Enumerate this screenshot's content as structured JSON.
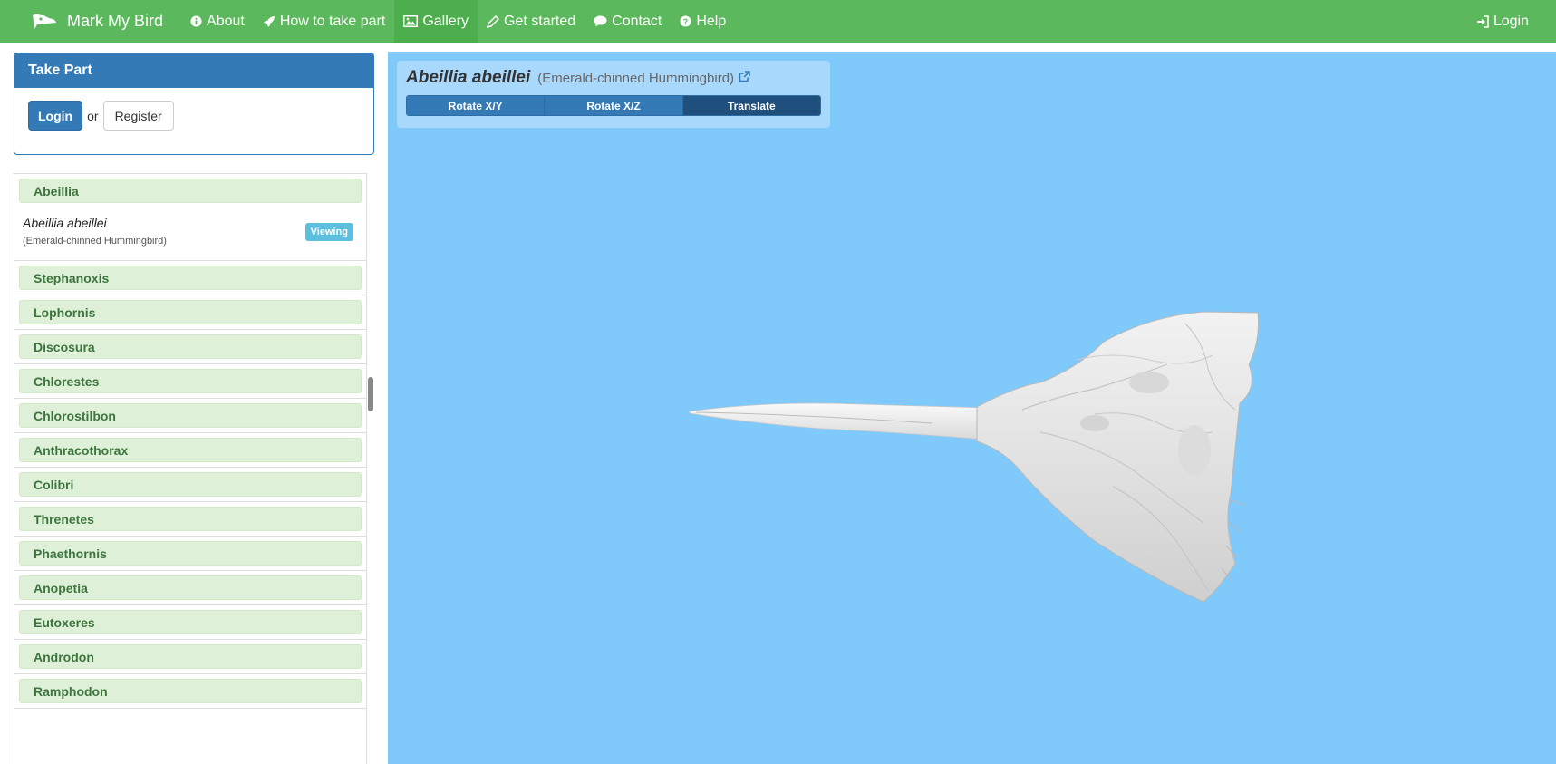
{
  "navbar": {
    "brand": "Mark My Bird",
    "items": [
      {
        "label": "About",
        "icon": "info-circle-icon"
      },
      {
        "label": "How to take part",
        "icon": "rocket-icon"
      },
      {
        "label": "Gallery",
        "icon": "picture-icon",
        "active": true
      },
      {
        "label": "Get started",
        "icon": "pencil-icon"
      },
      {
        "label": "Contact",
        "icon": "comment-icon"
      },
      {
        "label": "Help",
        "icon": "question-circle-icon"
      }
    ],
    "login": "Login"
  },
  "take_part": {
    "title": "Take Part",
    "login_label": "Login",
    "or_text": "or",
    "register_label": "Register"
  },
  "genus_list": {
    "first_genus": "Abeillia",
    "selected_species": {
      "scientific_name": "Abeillia abeillei",
      "common_name": "(Emerald-chinned Hummingbird)",
      "badge": "Viewing"
    },
    "genera": [
      "Stephanoxis",
      "Lophornis",
      "Discosura",
      "Chlorestes",
      "Chlorostilbon",
      "Anthracothorax",
      "Colibri",
      "Threnetes",
      "Phaethornis",
      "Anopetia",
      "Eutoxeres",
      "Androdon",
      "Ramphodon"
    ]
  },
  "viewer": {
    "scientific_name": "Abeillia abeillei",
    "common_name": "(Emerald-chinned Hummingbird)",
    "modes": [
      "Rotate X/Y",
      "Rotate X/Z",
      "Translate"
    ],
    "active_mode": "Translate",
    "background": "#80c9fb"
  },
  "colors": {
    "navbar": "#5cb85c",
    "primary": "#337ab7",
    "genus_bg": "#dff0d8",
    "genus_text": "#3c763d",
    "badge": "#5bc0de"
  }
}
